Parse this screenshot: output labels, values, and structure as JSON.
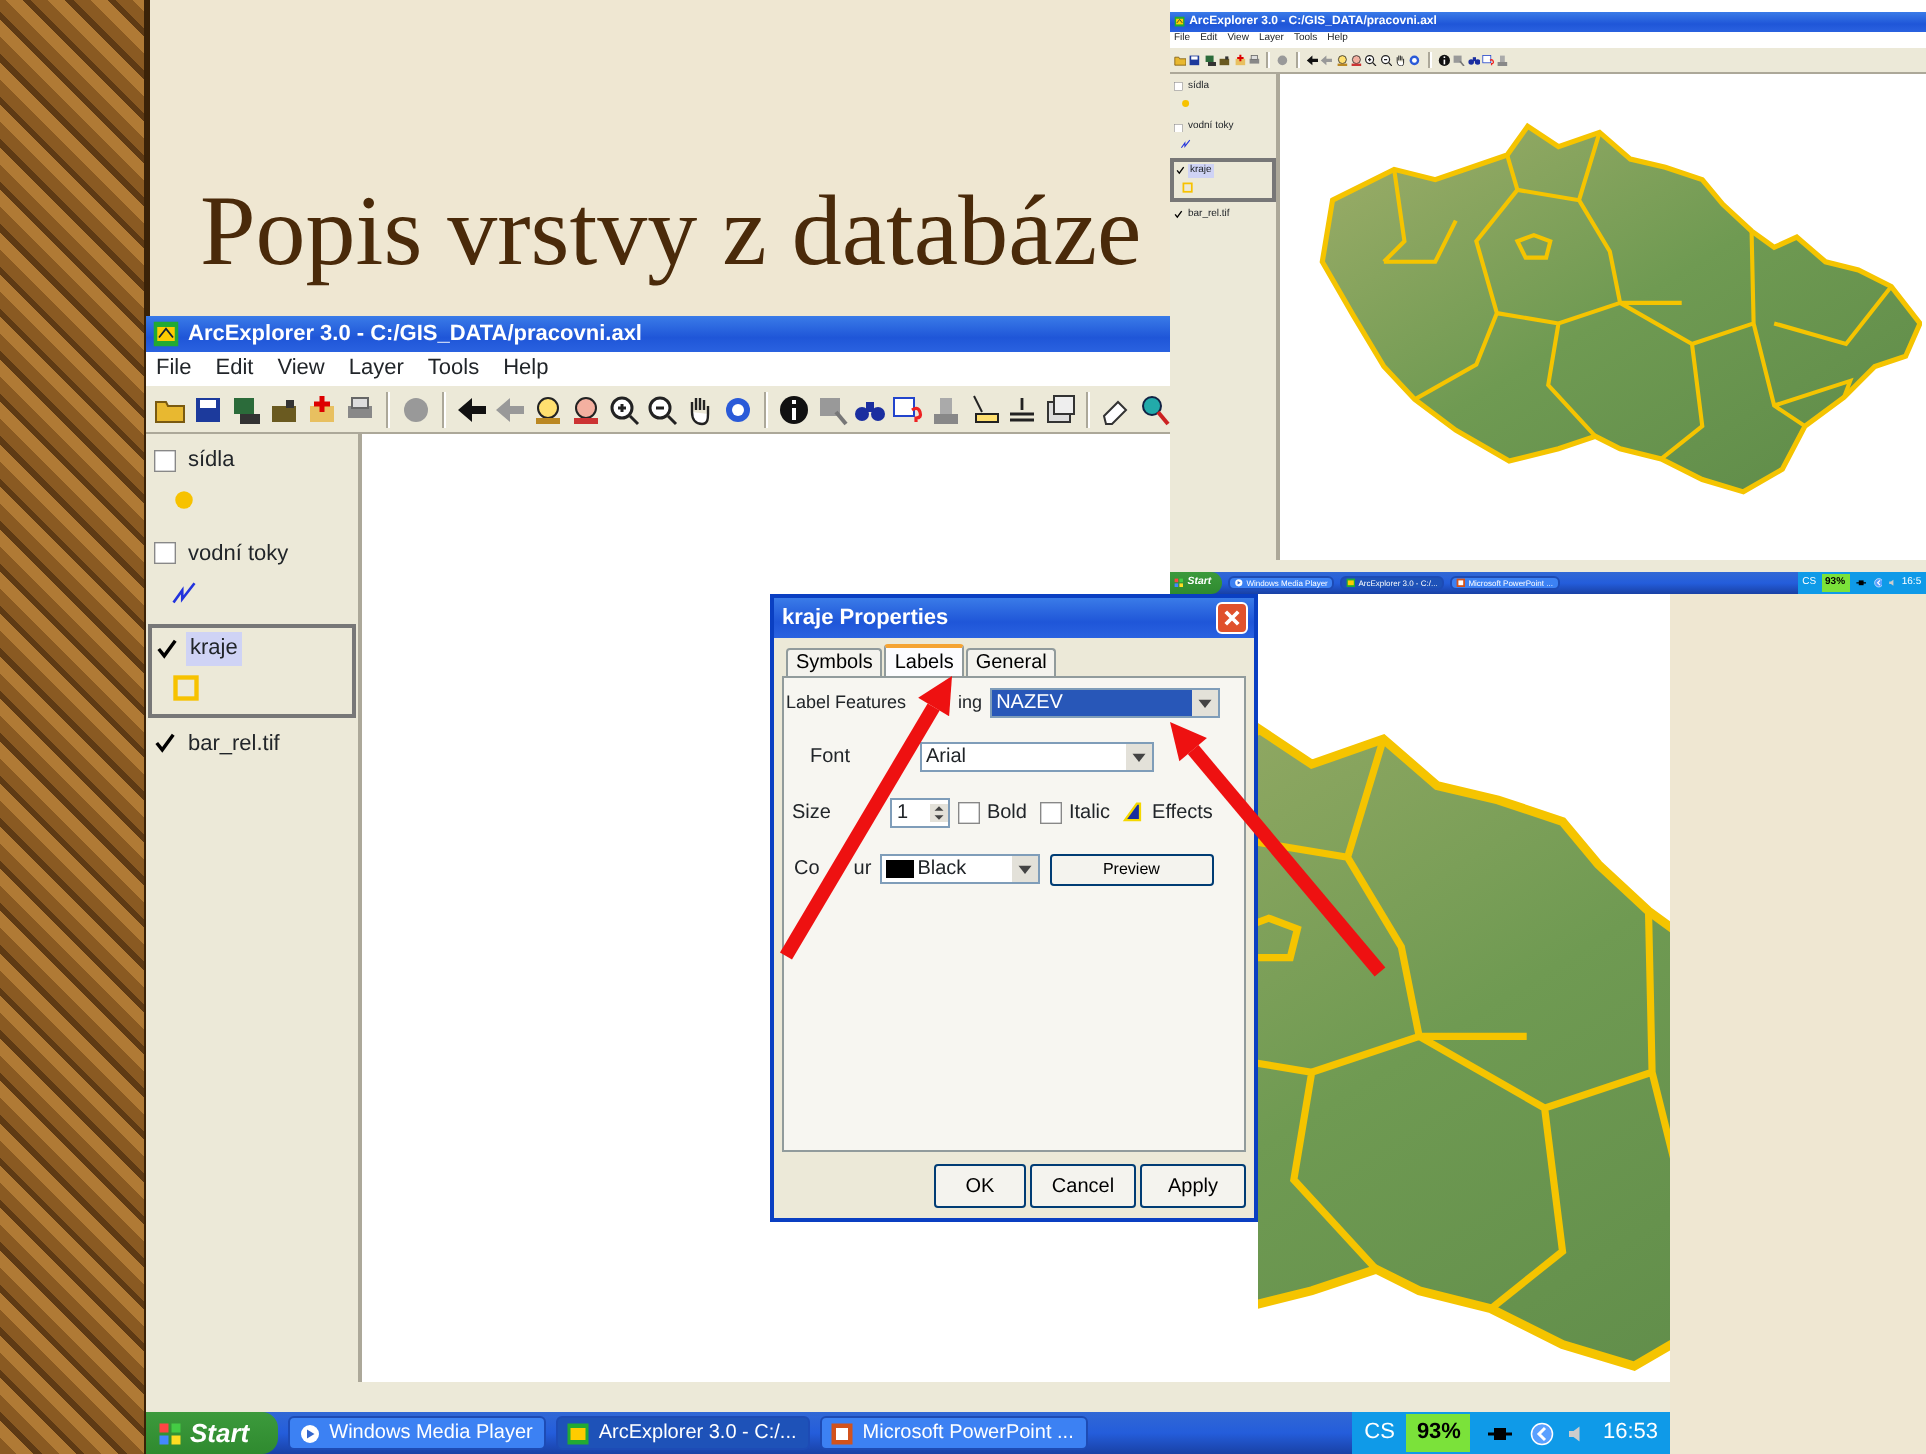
{
  "slide": {
    "title": "Popis vrstvy z databáze"
  },
  "inset_screenshot": {
    "title": "ArcExplorer 3.0 - C:/GIS_DATA/pracovni.axl",
    "menu": [
      "File",
      "Edit",
      "View",
      "Layer",
      "Tools",
      "Help"
    ],
    "layers": [
      {
        "name": "sídla",
        "checked": false,
        "selected": false,
        "kind": "point"
      },
      {
        "name": "vodní toky",
        "checked": false,
        "selected": false,
        "kind": "line"
      },
      {
        "name": "kraje",
        "checked": true,
        "selected": true,
        "kind": "polygon"
      },
      {
        "name": "bar_rel.tif",
        "checked": true,
        "selected": false,
        "kind": "raster"
      }
    ],
    "taskbar": {
      "start": "Start",
      "tasks": [
        {
          "label": "Windows Media Player",
          "selected": false
        },
        {
          "label": "ArcExplorer 3.0 - C:/...",
          "selected": true
        },
        {
          "label": "Microsoft PowerPoint ...",
          "selected": false
        }
      ],
      "language": "CS",
      "battery": "93%",
      "time": "16:5"
    }
  },
  "main_window": {
    "title": "ArcExplorer 3.0 - C:/GIS_DATA/pracovni.axl",
    "menu": [
      "File",
      "Edit",
      "View",
      "Layer",
      "Tools",
      "Help"
    ],
    "layers": [
      {
        "name": "sídla",
        "checked": false,
        "selected": false,
        "kind": "point"
      },
      {
        "name": "vodní toky",
        "checked": false,
        "selected": false,
        "kind": "line"
      },
      {
        "name": "kraje",
        "checked": true,
        "selected": true,
        "kind": "polygon"
      },
      {
        "name": "bar_rel.tif",
        "checked": true,
        "selected": false,
        "kind": "raster"
      }
    ],
    "taskbar": {
      "start": "Start",
      "tasks": [
        {
          "label": "Windows Media Player",
          "selected": false
        },
        {
          "label": "ArcExplorer 3.0 - C:/...",
          "selected": true
        },
        {
          "label": "Microsoft PowerPoint ...",
          "selected": false
        }
      ],
      "language": "CS",
      "battery": "93%",
      "time": "16:53"
    }
  },
  "dialog": {
    "title": "kraje Properties",
    "tabs": [
      {
        "label": "Symbols",
        "selected": false
      },
      {
        "label": "Labels",
        "selected": true
      },
      {
        "label": "General",
        "selected": false
      }
    ],
    "label_features_label_parts": [
      "Label Features",
      "ing"
    ],
    "label_field": "NAZEV",
    "font_label": "Font",
    "font": "Arial",
    "size_label": "Size",
    "size": "1",
    "bold": {
      "label": "Bold",
      "checked": false
    },
    "italic": {
      "label": "Italic",
      "checked": false
    },
    "effects": "Effects",
    "color_label_parts": [
      "Co",
      "ur"
    ],
    "color_choice": "Black",
    "preview": "Preview",
    "buttons": [
      "OK",
      "Cancel",
      "Apply"
    ]
  }
}
